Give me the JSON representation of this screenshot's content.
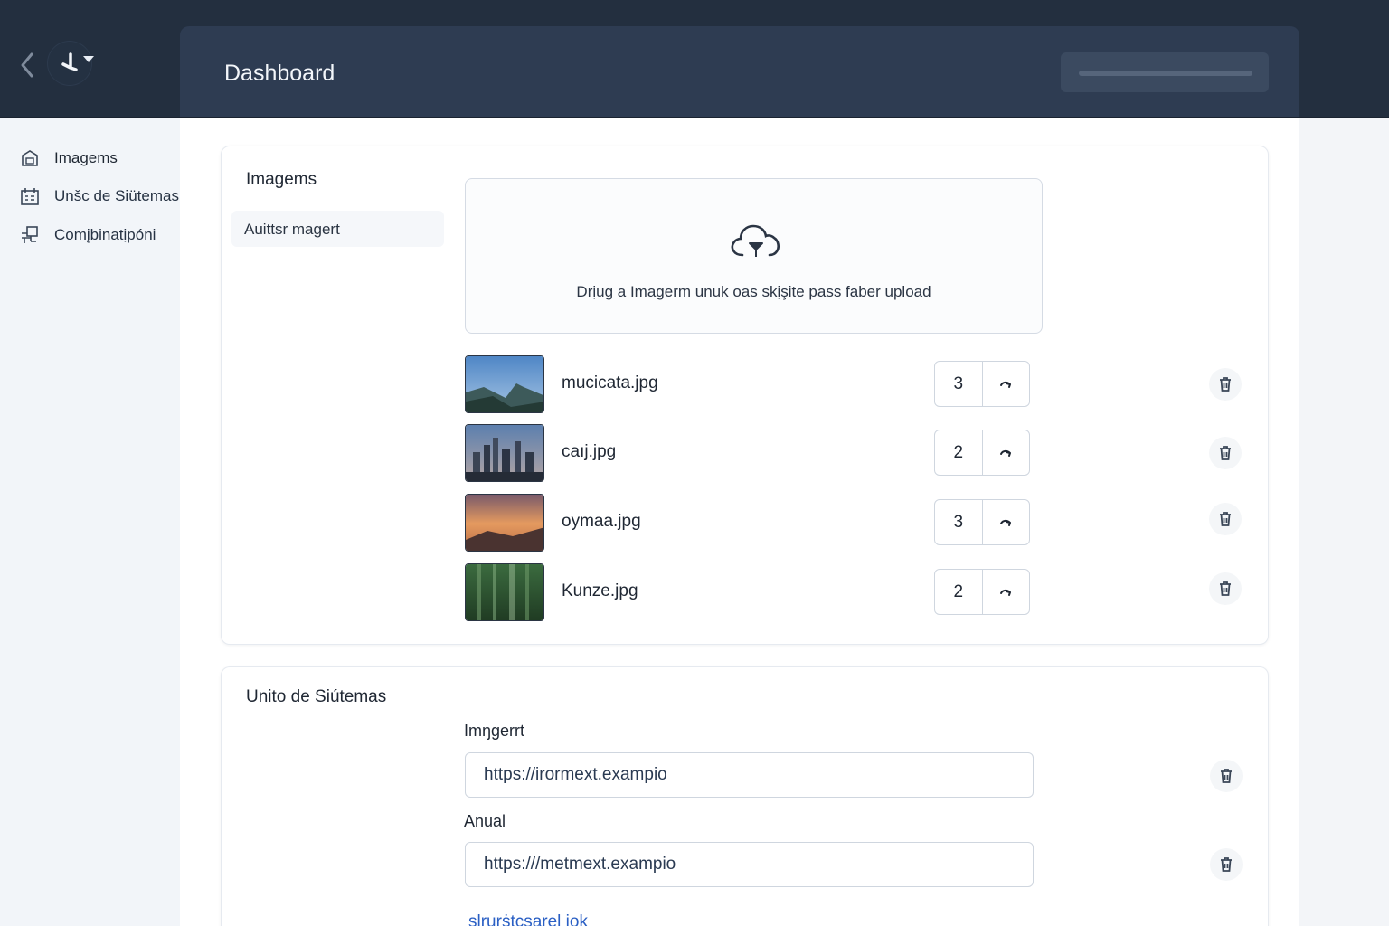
{
  "header": {
    "title": "Dashboard"
  },
  "sidebar": {
    "items": [
      {
        "label": "Imagems",
        "icon": "image-stack-icon"
      },
      {
        "label": "Unšc de Siütemas",
        "icon": "calendar-grid-icon"
      },
      {
        "label": "Comįbinatịpóni",
        "icon": "combination-icon"
      }
    ]
  },
  "images_card": {
    "title": "Imagems",
    "sub_tab": "Auittsr magert",
    "dropzone_text": "Drịug a Imagerm unuk oas skịşite pass faber upload",
    "files": [
      {
        "name": "mucicata.jpg",
        "quantity": "3",
        "thumb": "mountain"
      },
      {
        "name": "caıj.jpg",
        "quantity": "2",
        "thumb": "city"
      },
      {
        "name": "oymaa.jpg",
        "quantity": "3",
        "thumb": "sunset"
      },
      {
        "name": "Kunze.jpg",
        "quantity": "2",
        "thumb": "forest"
      }
    ]
  },
  "systems_card": {
    "title": "Unito de Siútemas",
    "fields": [
      {
        "label": "Imŋgerrt",
        "value": "https://irormext.exampio"
      },
      {
        "label": "Anual",
        "value": "https:///metmext.exampio"
      }
    ],
    "link": "slrurṡtcsarel iok"
  },
  "colors": {
    "topbar": "#232f3f",
    "header_panel": "#2e3c52",
    "link": "#2a5fc4"
  }
}
